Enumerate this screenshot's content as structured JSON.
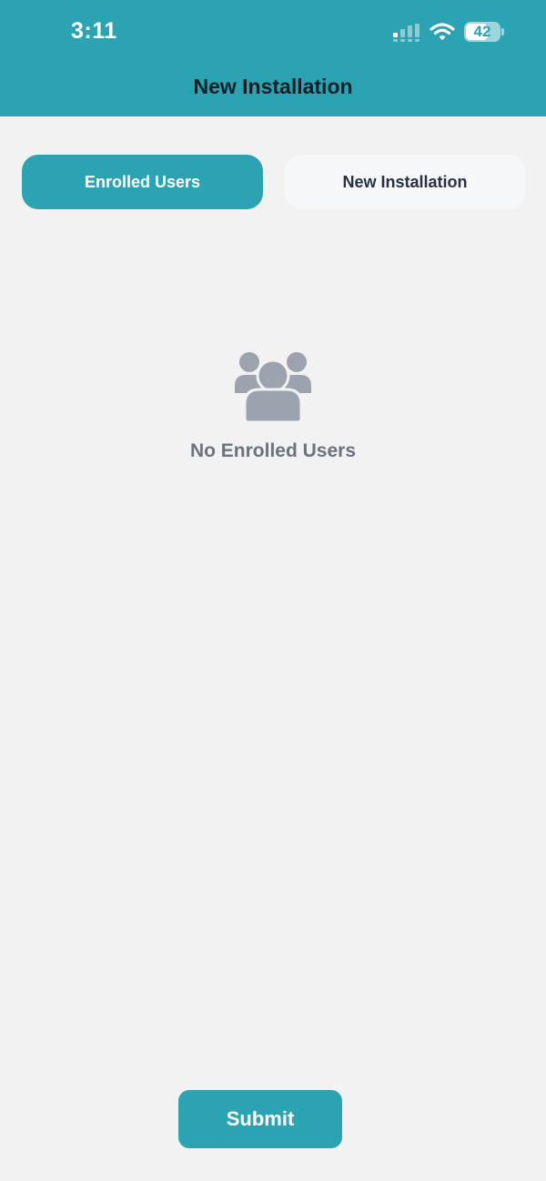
{
  "status_bar": {
    "time": "3:11",
    "battery_level": "42",
    "icons": [
      "signal-icon",
      "wifi-icon",
      "battery-icon"
    ]
  },
  "header": {
    "title": "New Installation"
  },
  "tabs": [
    {
      "label": "Enrolled Users",
      "active": true
    },
    {
      "label": "New Installation",
      "active": false
    }
  ],
  "empty_state": {
    "icon": "users-icon",
    "message": "No Enrolled Users"
  },
  "actions": {
    "submit_label": "Submit"
  },
  "colors": {
    "accent": "#2ba3b3",
    "background": "#f2f2f2",
    "muted_icon": "#9ca3af",
    "muted_text": "#6b7280"
  }
}
